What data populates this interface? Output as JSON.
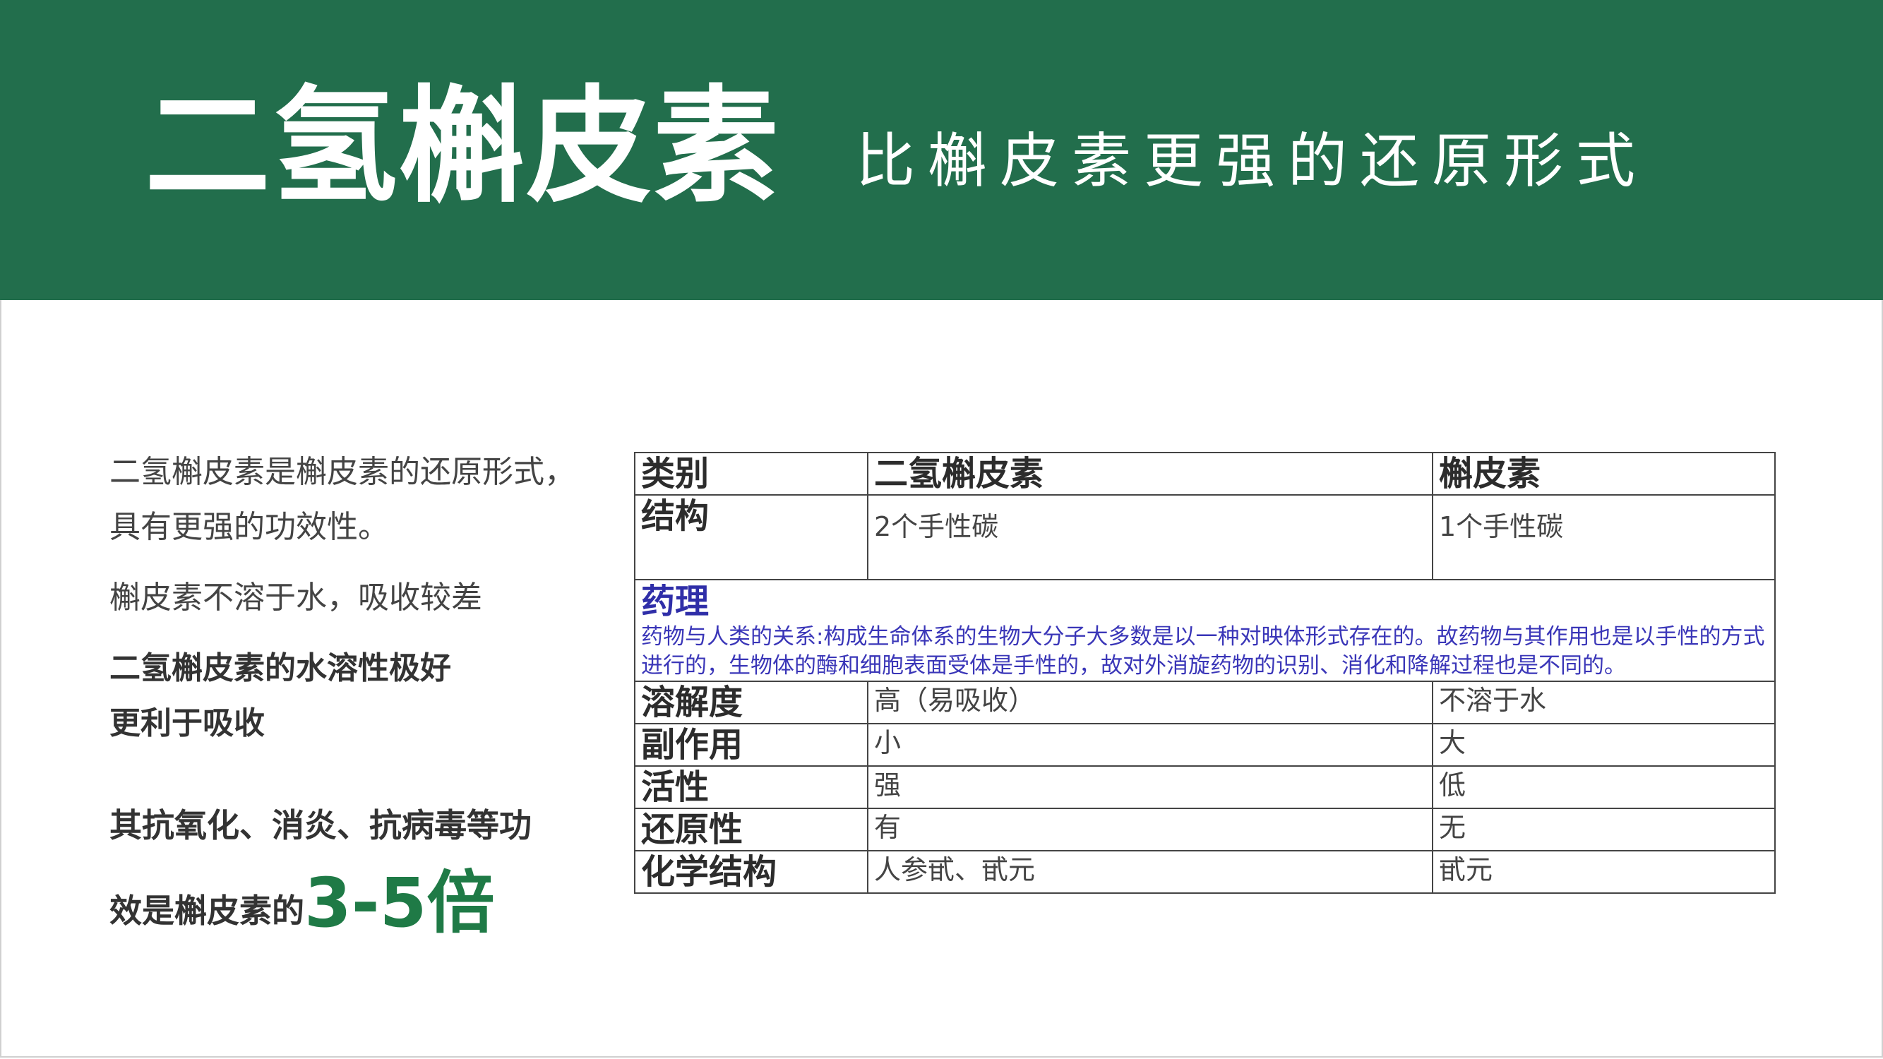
{
  "header": {
    "title": "二氢槲皮素",
    "subtitle": "比槲皮素更强的还原形式"
  },
  "left": {
    "para1": "二氢槲皮素是槲皮素的还原形式，具有更强的功效性。",
    "para2": "槲皮素不溶于水，吸收较差",
    "para3_line1": "二氢槲皮素的水溶性极好",
    "para3_line2": "更利于吸收",
    "para4_line1": "其抗氧化、消炎、抗病毒等功",
    "para4_line2_prefix": "效是槲皮素的",
    "para4_highlight": "3-5倍"
  },
  "table": {
    "header": [
      "类别",
      "二氢槲皮素",
      "槲皮素"
    ],
    "structure": {
      "label": "结构",
      "dhq": "2个手性碳",
      "q": "1个手性碳"
    },
    "pharmacology": {
      "title": "药理",
      "text": "药物与人类的关系:构成生命体系的生物大分子大多数是以一种对映体形式存在的。故药物与其作用也是以手性的方式进行的，生物体的酶和细胞表面受体是手性的，故对外消旋药物的识别、消化和降解过程也是不同的。"
    },
    "rows": [
      {
        "label": "溶解度",
        "dhq": "高（易吸收）",
        "q": "不溶于水"
      },
      {
        "label": "副作用",
        "dhq": "小",
        "q": "大"
      },
      {
        "label": "活性",
        "dhq": "强",
        "q": "低"
      },
      {
        "label": "还原性",
        "dhq": "有",
        "q": "无"
      },
      {
        "label": "化学结构",
        "dhq": "人参甙、甙元",
        "q": "甙元"
      }
    ]
  },
  "colors": {
    "banner": "#226e4c",
    "highlight": "#1f7a46",
    "pharmacology_text": "#3a36b8"
  }
}
